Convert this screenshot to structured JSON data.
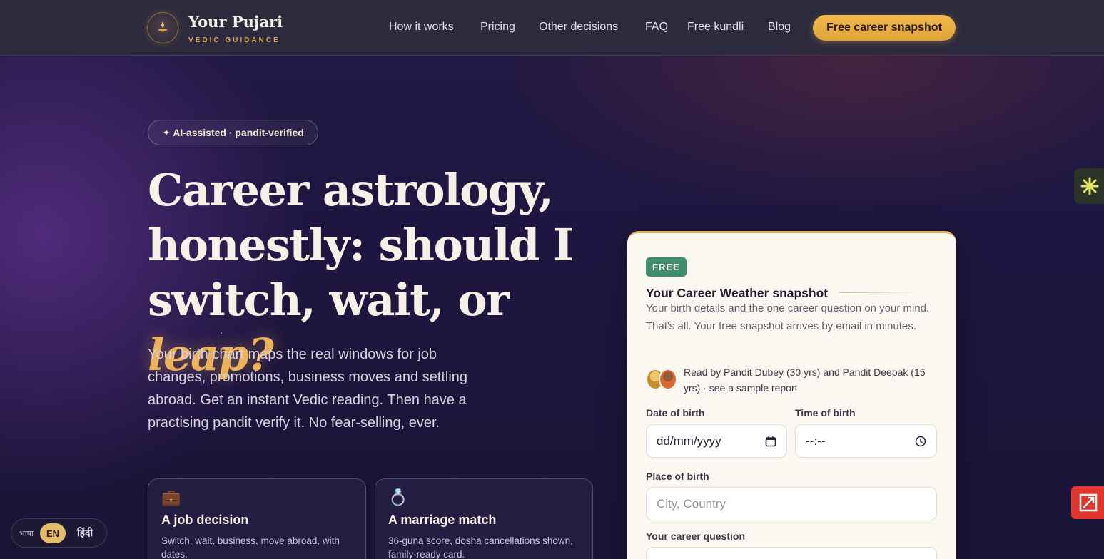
{
  "brand": {
    "name": "Your Pujari",
    "tagline": "VEDIC GUIDANCE",
    "logo_icon": "diya-lamp-icon"
  },
  "nav": {
    "items": [
      "How it works",
      "Pricing",
      "Other decisions",
      "FAQ",
      "Free kundli",
      "Blog"
    ],
    "cta": "Free career snapshot"
  },
  "hero": {
    "pill": "✦ AI-assisted · pandit-verified",
    "headline_line1": "Career astrology,",
    "headline_line2": "honestly: should I",
    "headline_line3_prefix": "switch, wait, or ",
    "headline_accent": "leap?",
    "subtext": "Your birth chart maps the real windows for job changes, promotions, business moves and settling abroad. Get an instant Vedic reading. Then have a practising pandit verify it. No fear-selling, ever."
  },
  "cards": [
    {
      "icon": "💼",
      "icon_name": "briefcase-icon",
      "title": "A job decision",
      "desc": "Switch, wait, business, move abroad, with dates."
    },
    {
      "icon": "💍",
      "icon_name": "ring-icon",
      "title": "A marriage match",
      "desc": "36-guna score, dosha cancellations shown, family-ready card."
    }
  ],
  "form": {
    "badge": "FREE",
    "title": "Your Career Weather snapshot",
    "description": "Your birth details and the one career question on your mind. That's all. Your free snapshot arrives by email in minutes.",
    "read_by": "Read by Pandit Dubey (30 yrs) and Pandit Deepak (15 yrs) · see a sample report",
    "dob_label": "Date of birth",
    "dob_value": "dd/mm/yyyy",
    "tob_label": "Time of birth",
    "tob_value": "--:--",
    "place_label": "Place of birth",
    "place_placeholder": "City, Country",
    "question_label": "Your career question"
  },
  "language": {
    "label": "भाषा",
    "en": "EN",
    "hi": "हिंदी",
    "selected": "EN"
  },
  "colors": {
    "accent": "#ecb25a",
    "cta": "#f0b94e",
    "free_badge": "#3f8d6c",
    "header_bg": "#2c2a3c",
    "panel_bg": "#fbf8f1"
  }
}
